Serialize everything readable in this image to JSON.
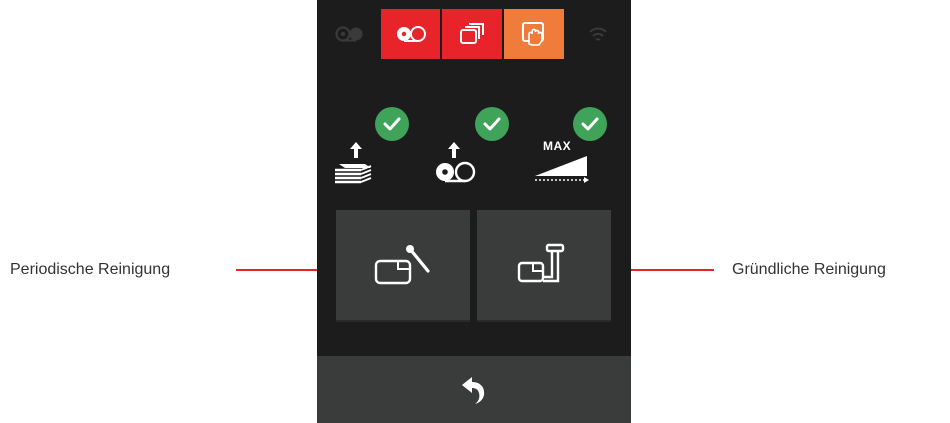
{
  "status_bar": {
    "items": [
      {
        "icon": "ribbon-icon",
        "state": "inactive"
      },
      {
        "icon": "ribbon-icon",
        "state": "error",
        "color": "#e8232a"
      },
      {
        "icon": "cards-stack-icon",
        "state": "error",
        "color": "#e8232a"
      },
      {
        "icon": "card-hand-icon",
        "state": "warning",
        "color": "#f07c3c"
      },
      {
        "icon": "wifi-icon",
        "state": "inactive"
      }
    ]
  },
  "status_row": {
    "items": [
      {
        "icon": "card-feeder-up-icon",
        "ok": true
      },
      {
        "icon": "ribbon-up-icon",
        "ok": true
      },
      {
        "icon": "max-capacity-icon",
        "label": "MAX",
        "ok": true
      }
    ],
    "ok_color": "#3fa35a"
  },
  "actions": {
    "periodic_icon": "cleaning-card-swab-icon",
    "deep_icon": "cleaning-card-pen-icon"
  },
  "back": {
    "icon": "back-arrow-icon"
  },
  "callouts": {
    "left": "Periodische Reinigung",
    "right": "Gründliche Reinigung"
  },
  "colors": {
    "accent": "#e8232a",
    "device_bg": "#1c1c1c",
    "tile": "#3a3c3c"
  }
}
